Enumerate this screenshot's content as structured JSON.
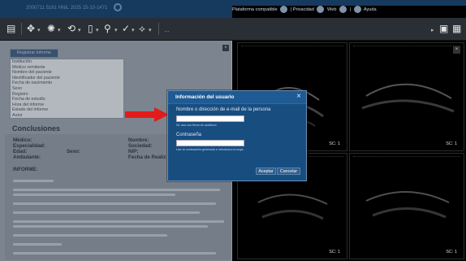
{
  "header": {
    "title": "2000711 5161 HNIL 2025 15-10-1471",
    "right_text": "Plataforma compatible",
    "privacy": "Privacidad",
    "web": "Web",
    "help": "Ayuda"
  },
  "left": {
    "register_button": "Registrar informe",
    "field_list": [
      "Institución",
      "Médico remitente",
      "Nombre del paciente",
      "Identificador del paciente",
      "Fecha de nacimiento",
      "Sexo",
      "Registro",
      "Fecha de estudio",
      "Hora del informe",
      "Estado del informe",
      "Autor"
    ],
    "conclusions_title": "Conclusiones",
    "labels": {
      "medico": "Médico:",
      "especialidad": "Especialidad:",
      "edad": "Edad:",
      "sexo": "Sexo:",
      "ambulante": "Ambulante:",
      "nombre": "Nombre:",
      "sociedad": "Sociedad:",
      "nip": "NIP:",
      "fecha": "Fecha de Realiz",
      "informe": "INFORME:"
    }
  },
  "viewer": {
    "scale_label": "SC: 1"
  },
  "dialog": {
    "title": "Información del usuario",
    "email_label": "Nombre o dirección de e-mail de la persona",
    "email_value": "",
    "email_hint": "Se usa con firma de auditoría",
    "password_label": "Contraseña",
    "password_value": "",
    "password_hint": "Use la contraseña generada e introdúzca la suya.",
    "accept_label": "Aceptar",
    "cancel_label": "Cancelar"
  }
}
